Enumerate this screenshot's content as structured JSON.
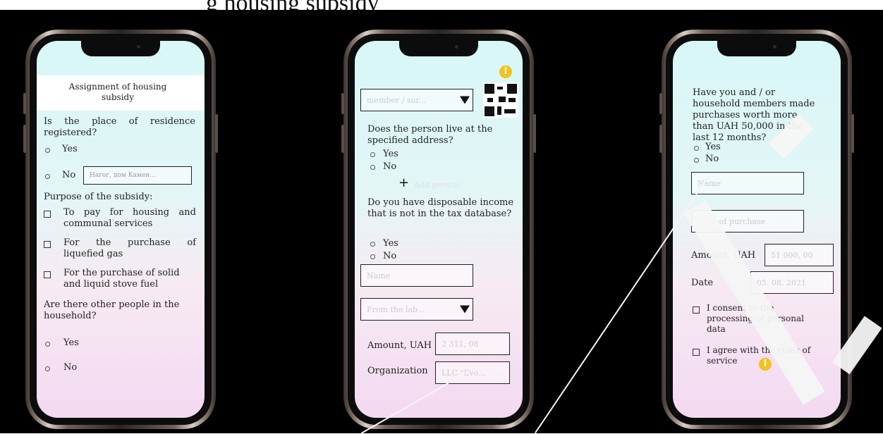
{
  "caption": "g housing subsidy",
  "phone1": {
    "title": "Assignment of housing subsidy",
    "q_registered": "Is the place of residence registered?",
    "opt_yes": "Yes",
    "opt_no": "No",
    "address_placeholder": "Нагог, дом Камен...",
    "purpose_label": "Purpose of the subsidy:",
    "purpose_1": "To pay for housing and communal services",
    "purpose_2": "For the purchase of liquefied gas",
    "purpose_3": "For the purchase of solid and liquid stove fuel",
    "q_other_people": "Are there other people in the household?",
    "opt_yes2": "Yes",
    "opt_no2": "No"
  },
  "phone2": {
    "select_placeholder": "member / sur...",
    "q_live": "Does the person live at the specified address?",
    "opt_yes": "Yes",
    "opt_no": "No",
    "add_label": "Add person",
    "q_income": "Do you have disposable income that is not in the tax database?",
    "opt_yes2": "Yes",
    "opt_no2": "No",
    "name_placeholder": "Name",
    "source_placeholder": "From the lab...",
    "amount_label": "Amount, UAH",
    "amount_placeholder": "2 311, 08",
    "org_label": "Organization",
    "org_placeholder": "LLC \"Evo..."
  },
  "phone3": {
    "q_purchases": "Have you and / or household members made purchases worth more than UAH 50,000 in the last 12 months?",
    "opt_yes": "Yes",
    "opt_no": "No",
    "name_placeholder": "Name",
    "type_placeholder": "Type of purchase",
    "amount_label": "Amount, UAH",
    "amount_placeholder": "51 000, 00",
    "date_label": "Date",
    "date_placeholder": "05. 08. 2021",
    "consent_label": "I consent to the processing of personal data",
    "rules_label": "I agree with the rules of service"
  },
  "colors": {
    "info": "#f3c21b",
    "screen_top": "#d8f7f7",
    "screen_bottom": "#f3d9f1"
  },
  "icons": [
    "info-icon",
    "qr-code-icon",
    "chevron-down-icon",
    "plus-icon"
  ]
}
